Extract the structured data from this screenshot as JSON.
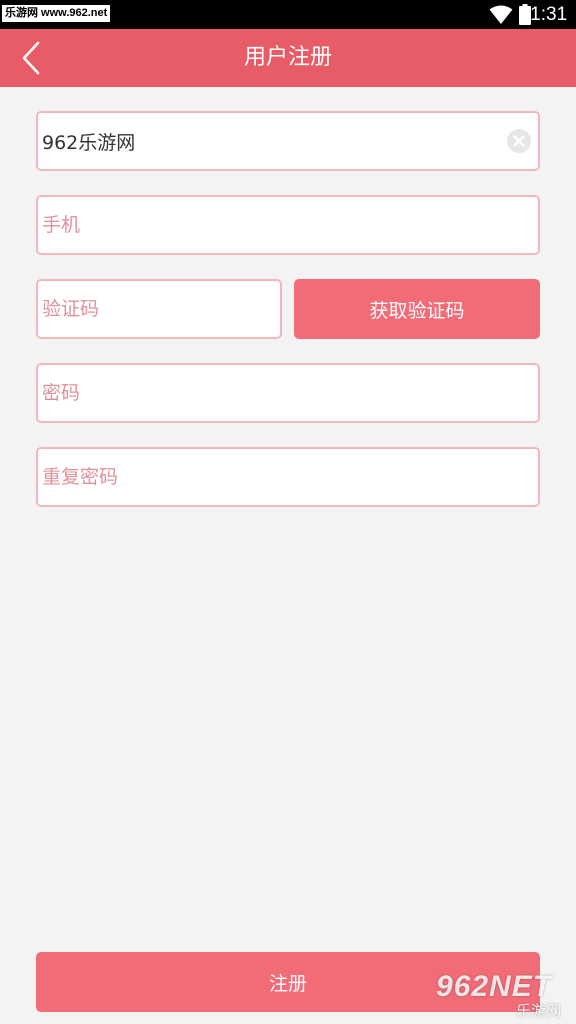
{
  "status_bar": {
    "watermark_text": "乐游网 www.962.net",
    "time": "11:31"
  },
  "app_bar": {
    "title": "用户注册",
    "back_icon": "chevron-left-icon"
  },
  "form": {
    "username": {
      "value": "962乐游网",
      "placeholder": ""
    },
    "phone": {
      "value": "",
      "placeholder": "手机"
    },
    "code": {
      "value": "",
      "placeholder": "验证码"
    },
    "get_code_label": "获取验证码",
    "password": {
      "value": "",
      "placeholder": "密码"
    },
    "confirm_password": {
      "value": "",
      "placeholder": "重复密码"
    },
    "submit_label": "注册"
  },
  "watermark": {
    "brand": "962NET",
    "sub": "乐游网"
  },
  "colors": {
    "app_bar": "#e85c67",
    "button": "#f26c78",
    "field_border": "#f1b7bd",
    "placeholder": "#e0929c",
    "background": "#f3f3f3"
  }
}
